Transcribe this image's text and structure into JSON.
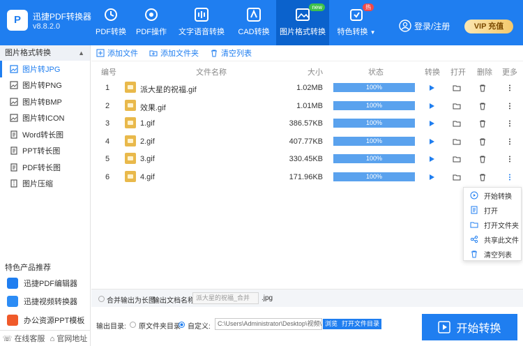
{
  "app": {
    "logo_text": "P",
    "name": "迅捷PDF转换器",
    "version": "v8.8.2.0"
  },
  "nav": [
    {
      "label": "PDF转换",
      "icon": "refresh-icon"
    },
    {
      "label": "PDF操作",
      "icon": "gear-icon"
    },
    {
      "label": "文字语音转换",
      "icon": "waveform-icon"
    },
    {
      "label": "CAD转换",
      "icon": "cad-icon"
    },
    {
      "label": "图片格式转换",
      "icon": "image-icon",
      "badge": "new",
      "active": true
    },
    {
      "label": "特色转换",
      "icon": "special-icon",
      "badge": "热"
    }
  ],
  "login_label": "登录/注册",
  "vip_label": "VIP 充值",
  "sidebar": {
    "title": "图片格式转换",
    "items": [
      "图片转JPG",
      "图片转PNG",
      "图片转BMP",
      "图片转ICON",
      "Word转长图",
      "PPT转长图",
      "PDF转长图",
      "图片压缩"
    ],
    "promo_title": "特色产品推荐",
    "promos": [
      "迅捷PDF编辑器",
      "迅捷视频转换器",
      "办公资源PPT模板"
    ],
    "bottom": [
      "在线客服",
      "官网地址"
    ]
  },
  "toolbar": {
    "add_file": "添加文件",
    "add_folder": "添加文件夹",
    "clear_list": "清空列表"
  },
  "table": {
    "headers": [
      "编号",
      "文件名称",
      "大小",
      "状态",
      "转换",
      "打开",
      "删除",
      "更多"
    ],
    "rows": [
      {
        "idx": "1",
        "name": "派大星的祝福.gif",
        "size": "1.02MB",
        "status": "100%",
        "progress": 100
      },
      {
        "idx": "2",
        "name": "效果.gif",
        "size": "1.01MB",
        "status": "100%",
        "progress": 100
      },
      {
        "idx": "3",
        "name": "1.gif",
        "size": "386.57KB",
        "status": "100%",
        "progress": 100
      },
      {
        "idx": "4",
        "name": "2.gif",
        "size": "407.77KB",
        "status": "100%",
        "progress": 100
      },
      {
        "idx": "5",
        "name": "3.gif",
        "size": "330.45KB",
        "status": "100%",
        "progress": 100
      },
      {
        "idx": "6",
        "name": "4.gif",
        "size": "171.96KB",
        "status": "100%",
        "progress": 100
      }
    ]
  },
  "context_menu": [
    "开始转换",
    "打开",
    "打开文件夹",
    "共享此文件",
    "清空列表"
  ],
  "merge": {
    "label": "合并输出为长图",
    "name_label": "输出文档名称:",
    "name_value": "派大星的祝福_合并",
    "ext": ".jpg"
  },
  "output": {
    "label": "输出目录:",
    "opt_source": "原文件夹目录",
    "opt_custom": "自定义:",
    "path": "C:\\Users\\Administrator\\Desktop\\视频\\动图",
    "browse": "浏览",
    "open_folder": "打开文件目录"
  },
  "start_label": "开始转换",
  "colors": {
    "primary": "#1f7ef0",
    "active_nav": "#0b62cc",
    "progress": "#5aa2ee"
  }
}
